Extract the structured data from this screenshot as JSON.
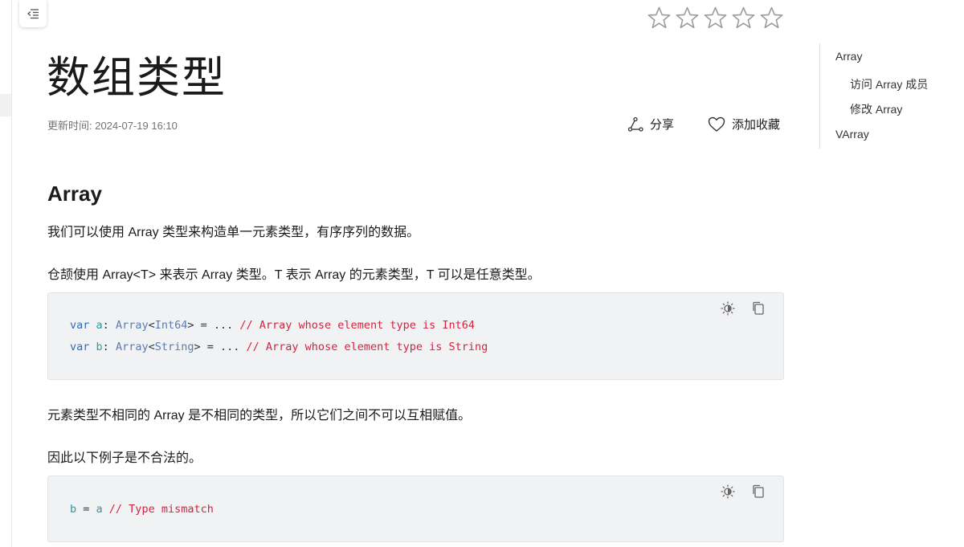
{
  "page": {
    "title": "数组类型",
    "updated_label": "更新时间: 2024-07-19 16:10"
  },
  "actions": {
    "share_label": "分享",
    "favorite_label": "添加收藏"
  },
  "rating": {
    "stars_total": 5,
    "stars_filled": 0
  },
  "toc": {
    "items": [
      {
        "label": "Array",
        "level": 1
      },
      {
        "label": "访问 Array 成员",
        "level": 2
      },
      {
        "label": "修改 Array",
        "level": 2
      },
      {
        "label": "VArray",
        "level": 1
      }
    ]
  },
  "content": {
    "heading": "Array",
    "p1": "我们可以使用 Array 类型来构造单一元素类型，有序序列的数据。",
    "p2": "仓颉使用 Array<T> 来表示 Array 类型。T 表示 Array 的元素类型，T 可以是任意类型。",
    "code1": {
      "line1": {
        "kw": "var",
        "id": "a",
        "colon": ": ",
        "ty1": "Array",
        "lt": "<",
        "ty2": "Int64",
        "gt": "> = ... ",
        "comment": "// Array whose element type is Int64"
      },
      "line2": {
        "kw": "var",
        "id": "b",
        "colon": ": ",
        "ty1": "Array",
        "lt": "<",
        "ty2": "String",
        "gt": "> = ... ",
        "comment": "// Array whose element type is String"
      }
    },
    "p3": "元素类型不相同的 Array 是不相同的类型，所以它们之间不可以互相赋值。",
    "p4": "因此以下例子是不合法的。",
    "code2": {
      "line1": {
        "lhs": "b",
        "eq": " = ",
        "rhs": "a",
        "comment": " // Type mismatch"
      }
    }
  },
  "colors": {
    "keyword": "#2e6db5",
    "identifier": "#2a9a9a",
    "type": "#5b7cb0",
    "comment": "#d0253f",
    "code_bg": "#f1f2f4"
  }
}
